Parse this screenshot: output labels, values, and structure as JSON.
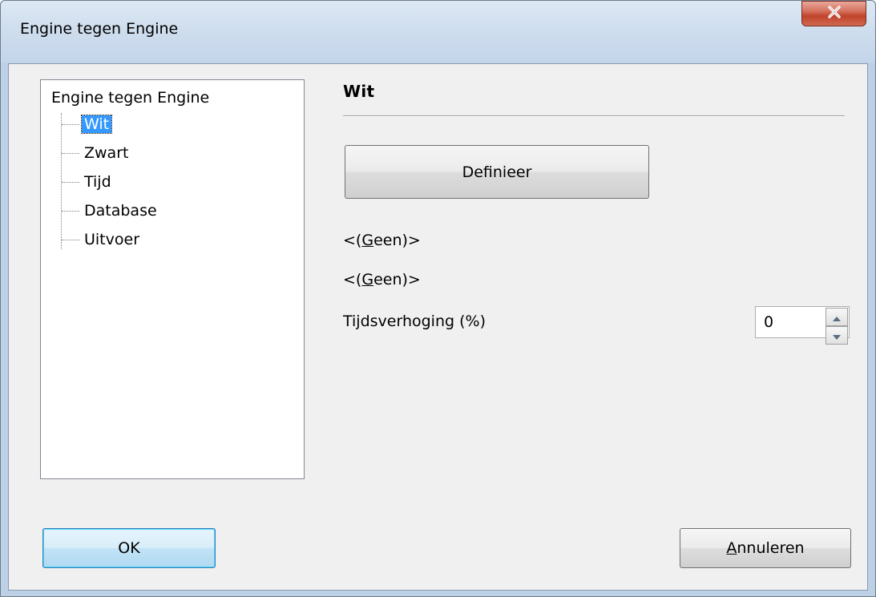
{
  "window": {
    "title": "Engine tegen Engine"
  },
  "tree": {
    "root": "Engine tegen Engine",
    "items": [
      {
        "label": "Wit",
        "selected": true
      },
      {
        "label": "Zwart",
        "selected": false
      },
      {
        "label": "Tijd",
        "selected": false
      },
      {
        "label": "Database",
        "selected": false
      },
      {
        "label": "Uitvoer",
        "selected": false
      }
    ]
  },
  "panel": {
    "title": "Wit",
    "define_button": "Definieer",
    "engine_label_1": {
      "prefix": "<(",
      "mnemonic": "G",
      "rest": "een)>"
    },
    "engine_label_2": {
      "prefix": "<(",
      "mnemonic": "G",
      "rest": "een)>"
    },
    "time_increase_label": "Tijdsverhoging (%)",
    "time_increase_value": "0"
  },
  "footer": {
    "ok_label": "OK",
    "cancel_mnemonic": "A",
    "cancel_rest": "nnuleren"
  },
  "icons": {
    "close": "close-icon",
    "spin_up": "arrow-up-icon",
    "spin_down": "arrow-down-icon"
  },
  "colors": {
    "selection": "#3399ff",
    "close_button": "#c0432b",
    "dialog_bg": "#f0f0f0"
  }
}
